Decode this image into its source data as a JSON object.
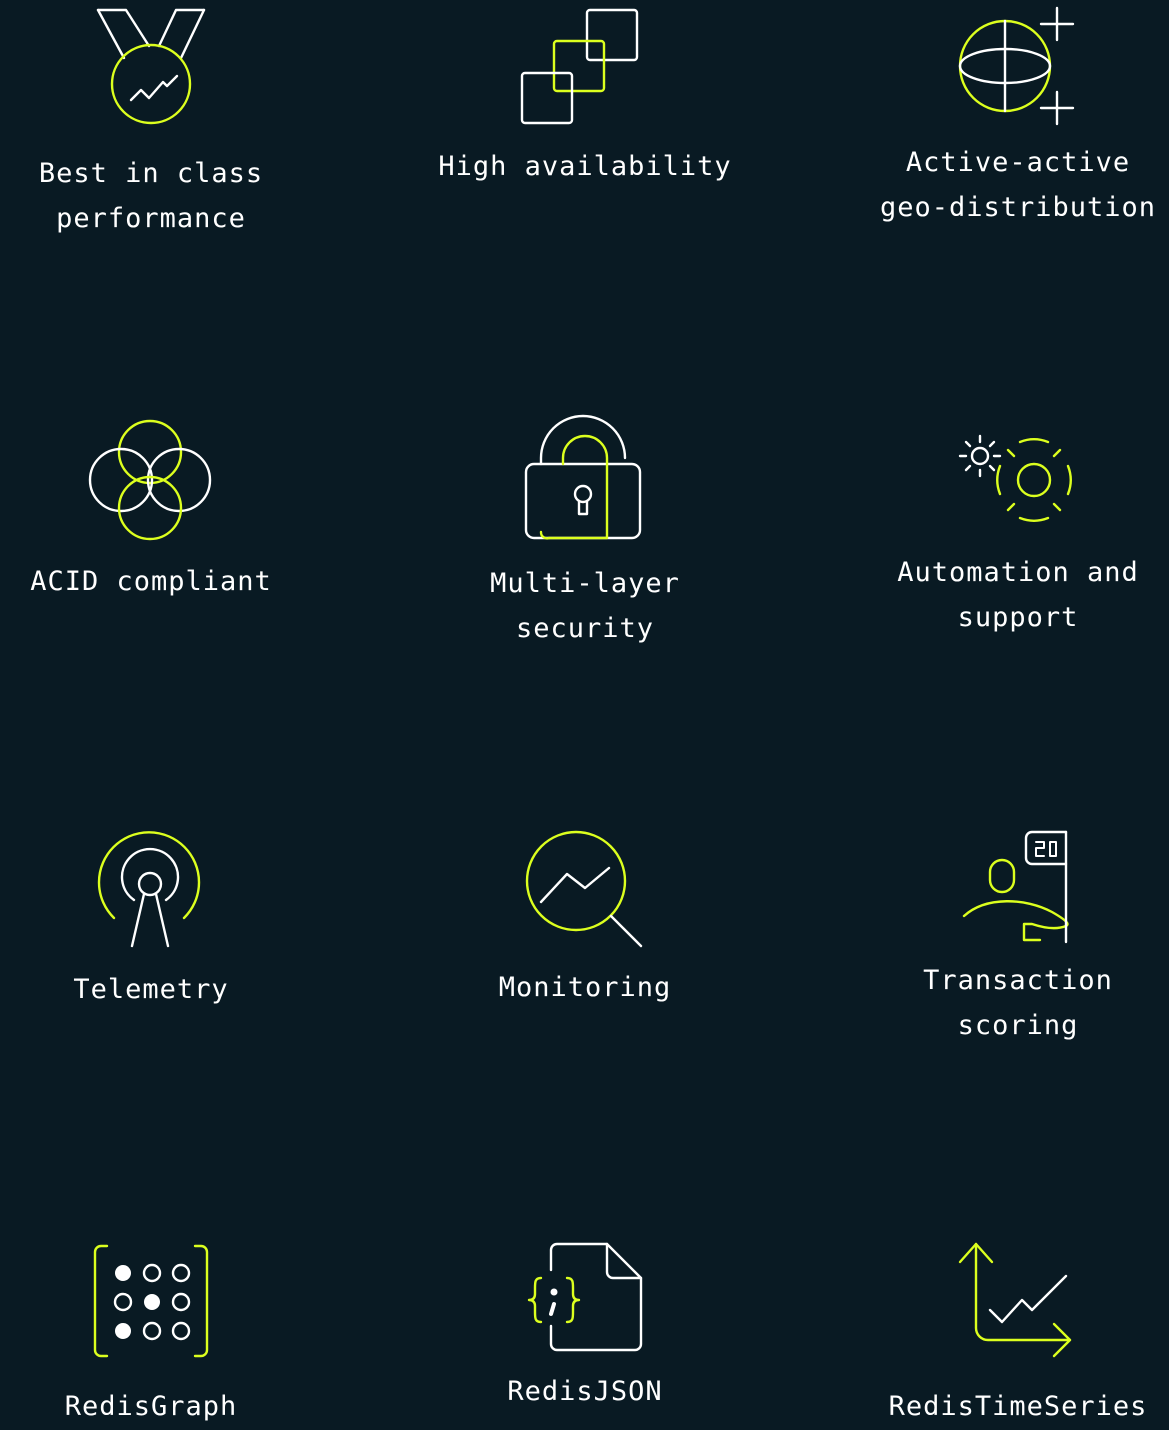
{
  "colors": {
    "background": "#091a23",
    "accent": "#dcff1e",
    "foreground": "#ffffff"
  },
  "features": [
    {
      "label": "Best in class\nperformance",
      "icon": "medal-icon"
    },
    {
      "label": "High availability",
      "icon": "stacked-squares-icon"
    },
    {
      "label": "Active-active\ngeo-distribution",
      "icon": "globe-plus-icon"
    },
    {
      "label": "ACID compliant",
      "icon": "overlapping-circles-icon"
    },
    {
      "label": "Multi-layer\nsecurity",
      "icon": "padlock-icon"
    },
    {
      "label": "Automation and\nsupport",
      "icon": "gears-icon"
    },
    {
      "label": "Telemetry",
      "icon": "antenna-icon"
    },
    {
      "label": "Monitoring",
      "icon": "magnifier-chart-icon"
    },
    {
      "label": "Transaction\nscoring",
      "icon": "person-score-flag-icon"
    },
    {
      "label": "RedisGraph",
      "icon": "dot-grid-icon"
    },
    {
      "label": "RedisJSON",
      "icon": "json-file-icon"
    },
    {
      "label": "RedisTimeSeries",
      "icon": "time-series-chart-icon"
    }
  ]
}
